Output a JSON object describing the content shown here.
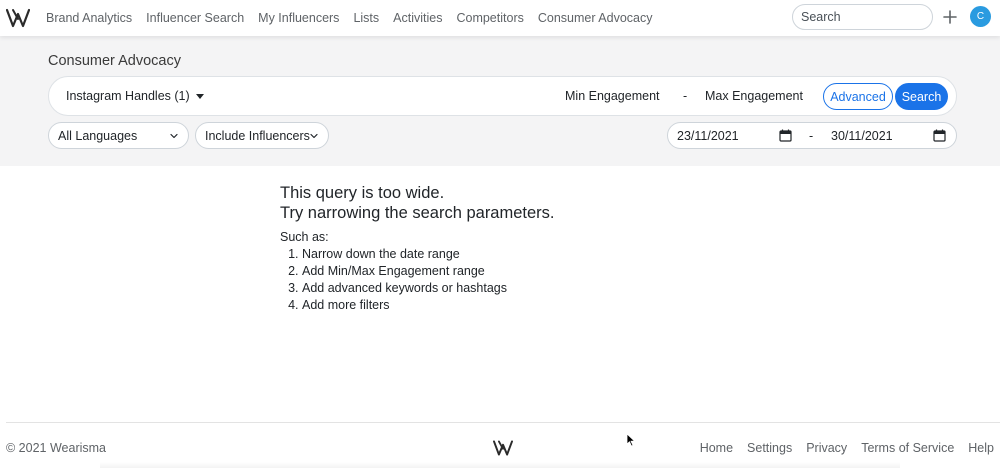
{
  "nav": {
    "links": [
      "Brand Analytics",
      "Influencer Search",
      "My Influencers",
      "Lists",
      "Activities",
      "Competitors",
      "Consumer Advocacy"
    ],
    "search_placeholder": "Search",
    "avatar_letter": "C",
    "logo_icon": "wearisma-logo-icon",
    "plus_icon": "plus-icon"
  },
  "filters": {
    "title": "Consumer Advocacy",
    "handles_label": "Instagram Handles (1)",
    "min_engagement": "Min Engagement",
    "range_dash": "-",
    "max_engagement": "Max Engagement",
    "advanced_label": "Advanced",
    "search_label": "Search",
    "language_selected": "All Languages",
    "influencer_selected": "Include Influencers",
    "date_from": "23/11/2021",
    "date_dash": "-",
    "date_to": "30/11/2021"
  },
  "message": {
    "line1": "This query is too wide.",
    "line2": "Try narrowing the search parameters.",
    "such_as": "Such as:",
    "suggestions": [
      "Narrow down the date range",
      "Add Min/Max Engagement range",
      "Add advanced keywords or hashtags",
      "Add more filters"
    ]
  },
  "footer": {
    "copyright": "© 2021 Wearisma",
    "links": [
      "Home",
      "Settings",
      "Privacy",
      "Terms of Service",
      "Help"
    ]
  },
  "colors": {
    "accent": "#1a73e8",
    "avatar": "#2a9be0",
    "filter_bg": "#f4f4f5"
  }
}
